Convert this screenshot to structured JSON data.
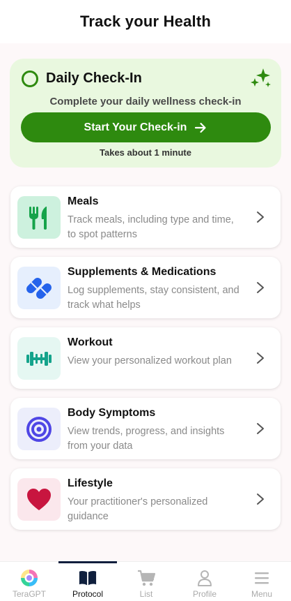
{
  "header": {
    "title": "Track your Health"
  },
  "checkin": {
    "title": "Daily Check-In",
    "subtitle": "Complete your daily wellness check-in",
    "button_label": "Start Your Check-in",
    "note": "Takes about 1 minute",
    "accent_color": "#2e8a0f",
    "background_color": "#e9f8df"
  },
  "cards": [
    {
      "title": "Meals",
      "description": "Track meals, including type and time, to spot patterns",
      "icon": "fork-knife-icon",
      "icon_bg": "#cdf1de",
      "icon_color": "#16a34a"
    },
    {
      "title": "Supplements & Medications",
      "description": "Log supplements, stay consistent, and track what helps",
      "icon": "pills-icon",
      "icon_bg": "#e6effd",
      "icon_color": "#2563eb"
    },
    {
      "title": "Workout",
      "description": "View your personalized workout plan",
      "icon": "dumbbell-icon",
      "icon_bg": "#e5f7f2",
      "icon_color": "#14a38b"
    },
    {
      "title": "Body Symptoms",
      "description": "View trends, progress, and insights from your data",
      "icon": "target-icon",
      "icon_bg": "#eceefb",
      "icon_color": "#4f46e5"
    },
    {
      "title": "Lifestyle",
      "description": "Your practitioner's personalized guidance",
      "icon": "heart-icon",
      "icon_bg": "#fbe7ec",
      "icon_color": "#c8153f"
    }
  ],
  "tabbar": {
    "tabs": [
      {
        "label": "TeraGPT",
        "icon": "teragpt-logo-icon",
        "active": false
      },
      {
        "label": "Protocol",
        "icon": "book-icon",
        "active": true
      },
      {
        "label": "List",
        "icon": "cart-icon",
        "active": false
      },
      {
        "label": "Profile",
        "icon": "person-icon",
        "active": false
      },
      {
        "label": "Menu",
        "icon": "hamburger-menu-icon",
        "active": false
      }
    ]
  }
}
